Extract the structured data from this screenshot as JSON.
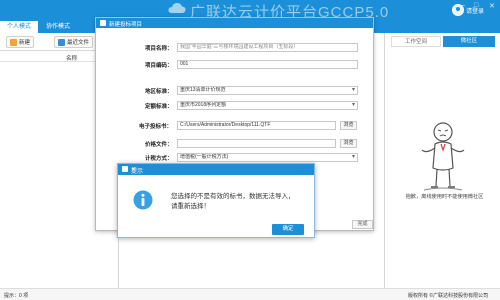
{
  "app": {
    "title": "广联达云计价平台GCCP5.0",
    "user_label": "请登录",
    "window_buttons": [
      "—",
      "□",
      "✕"
    ]
  },
  "mode_tabs": [
    {
      "label": "个人模式",
      "active": true
    },
    {
      "label": "协作模式",
      "active": false
    }
  ],
  "left_toolbar": {
    "new_label": "新建",
    "open_label": "最近文件"
  },
  "file_list": {
    "column_name": "名称"
  },
  "right_panel": {
    "tabs": [
      {
        "label": "工作空间",
        "active": false
      },
      {
        "label": "微社区",
        "active": true
      }
    ],
    "message": "抱歉，离线使用时不能使用微社区"
  },
  "status_bar": {
    "left": "提示：0 项",
    "right": "版权所有 ©广联达科技股份有限公司"
  },
  "dialog": {
    "title": "新建投标项目",
    "fields": [
      {
        "label": "项目名称：",
        "value": "我国“丰园华庭”三号楼环境园建设工程项目（五标段）"
      },
      {
        "label": "项目编码：",
        "value": "001"
      },
      {
        "label": "地区标准：",
        "value": "重庆13清单计价规范"
      },
      {
        "label": "定额标准：",
        "value": "重庆市2018序列定额"
      },
      {
        "label": "电子投标书：",
        "value": "C:/Users/Administrator/Desktop/111.QTF"
      },
      {
        "label": "价格文件：",
        "value": ""
      },
      {
        "label": "计税方式：",
        "value": "增值税(一般计税方法)"
      }
    ],
    "browse_label": "浏览",
    "finish_label": "完成"
  },
  "alert": {
    "title": "提示",
    "message": "您选择的不是有效的标书，数据无法导入，请重新选择！",
    "ok_label": "确定",
    "close_glyph": "✕"
  },
  "colors": {
    "brand_blue": "#1b8fd8",
    "info_icon": "#39a0e4"
  }
}
